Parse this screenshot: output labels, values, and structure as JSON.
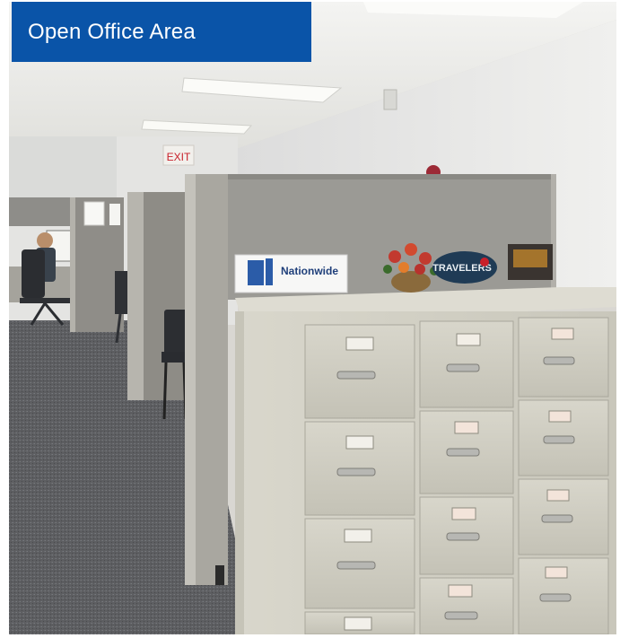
{
  "caption": {
    "text": "Open Office Area",
    "background": "#0a54a8",
    "color": "#ffffff"
  },
  "photo": {
    "exit_sign": "EXIT",
    "sign_nationwide": "Nationwide",
    "sign_travelers": "TRAVELERS"
  },
  "colors": {
    "cabinet": "#d3d1c6",
    "cabinet_shadow": "#b9b7ab",
    "partition": "#9a9891",
    "carpet": "#5e5f62",
    "wall": "#e6e6e4",
    "ceiling": "#ededeb",
    "exit_red": "#c8202a"
  }
}
